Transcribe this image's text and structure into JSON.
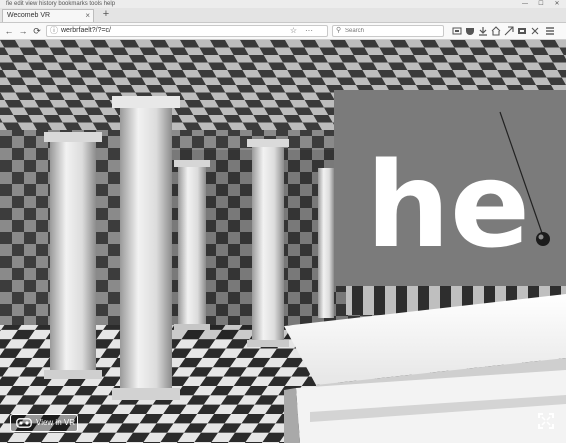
{
  "window": {
    "title": "fie  edit  view  history  bookmarks  tools  help",
    "controls": [
      "—",
      "☐",
      "✕"
    ]
  },
  "tabs": [
    {
      "label": "Wecomeb VR",
      "close": "×"
    }
  ],
  "new_tab_label": "+",
  "toolbar": {
    "back": "←",
    "forward": "→",
    "reload": "⟳",
    "info_icon": "ⓘ",
    "url": "werbrfaelt?/?=c/",
    "bookmark_icon": "☆",
    "more_icon": "···",
    "search_placeholder": "Search",
    "icons": [
      "home-icon",
      "pocket-icon",
      "download-icon",
      "library-icon",
      "send-icon",
      "screenshot-icon",
      "sync-icon",
      "addon-icon",
      "menu-icon"
    ]
  },
  "scene": {
    "sign_text": "he",
    "floor_colors": [
      "#2a2a2a",
      "#e8e8e8"
    ],
    "sign_color": "#7a7a7a"
  },
  "vr_button": {
    "label": "View in VR"
  },
  "fullscreen_icon": "fullscreen-icon"
}
